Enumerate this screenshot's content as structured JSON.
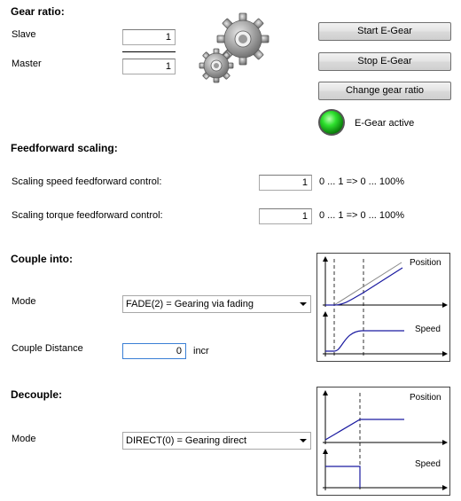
{
  "gear_ratio": {
    "title": "Gear ratio:",
    "slave_label": "Slave",
    "slave_value": "1",
    "master_label": "Master",
    "master_value": "1"
  },
  "buttons": {
    "start": "Start E-Gear",
    "stop": "Stop E-Gear",
    "change": "Change gear ratio"
  },
  "status": {
    "label": "E-Gear active",
    "color": "#1fc41f"
  },
  "feedforward": {
    "title": "Feedforward scaling:",
    "speed_label": "Scaling speed feedforward control:",
    "speed_value": "1",
    "speed_hint": "0 ... 1 => 0 ... 100%",
    "torque_label": "Scaling torque feedforward control:",
    "torque_value": "1",
    "torque_hint": "0 ... 1 => 0 ... 100%"
  },
  "couple": {
    "title": "Couple into:",
    "mode_label": "Mode",
    "mode_value": "FADE(2) = Gearing via fading",
    "distance_label": "Couple Distance",
    "distance_value": "0",
    "distance_unit": "incr",
    "diagram": {
      "position_label": "Position",
      "speed_label": "Speed"
    }
  },
  "decouple": {
    "title": "Decouple:",
    "mode_label": "Mode",
    "mode_value": "DIRECT(0) = Gearing direct",
    "diagram": {
      "position_label": "Position",
      "speed_label": "Speed"
    }
  }
}
